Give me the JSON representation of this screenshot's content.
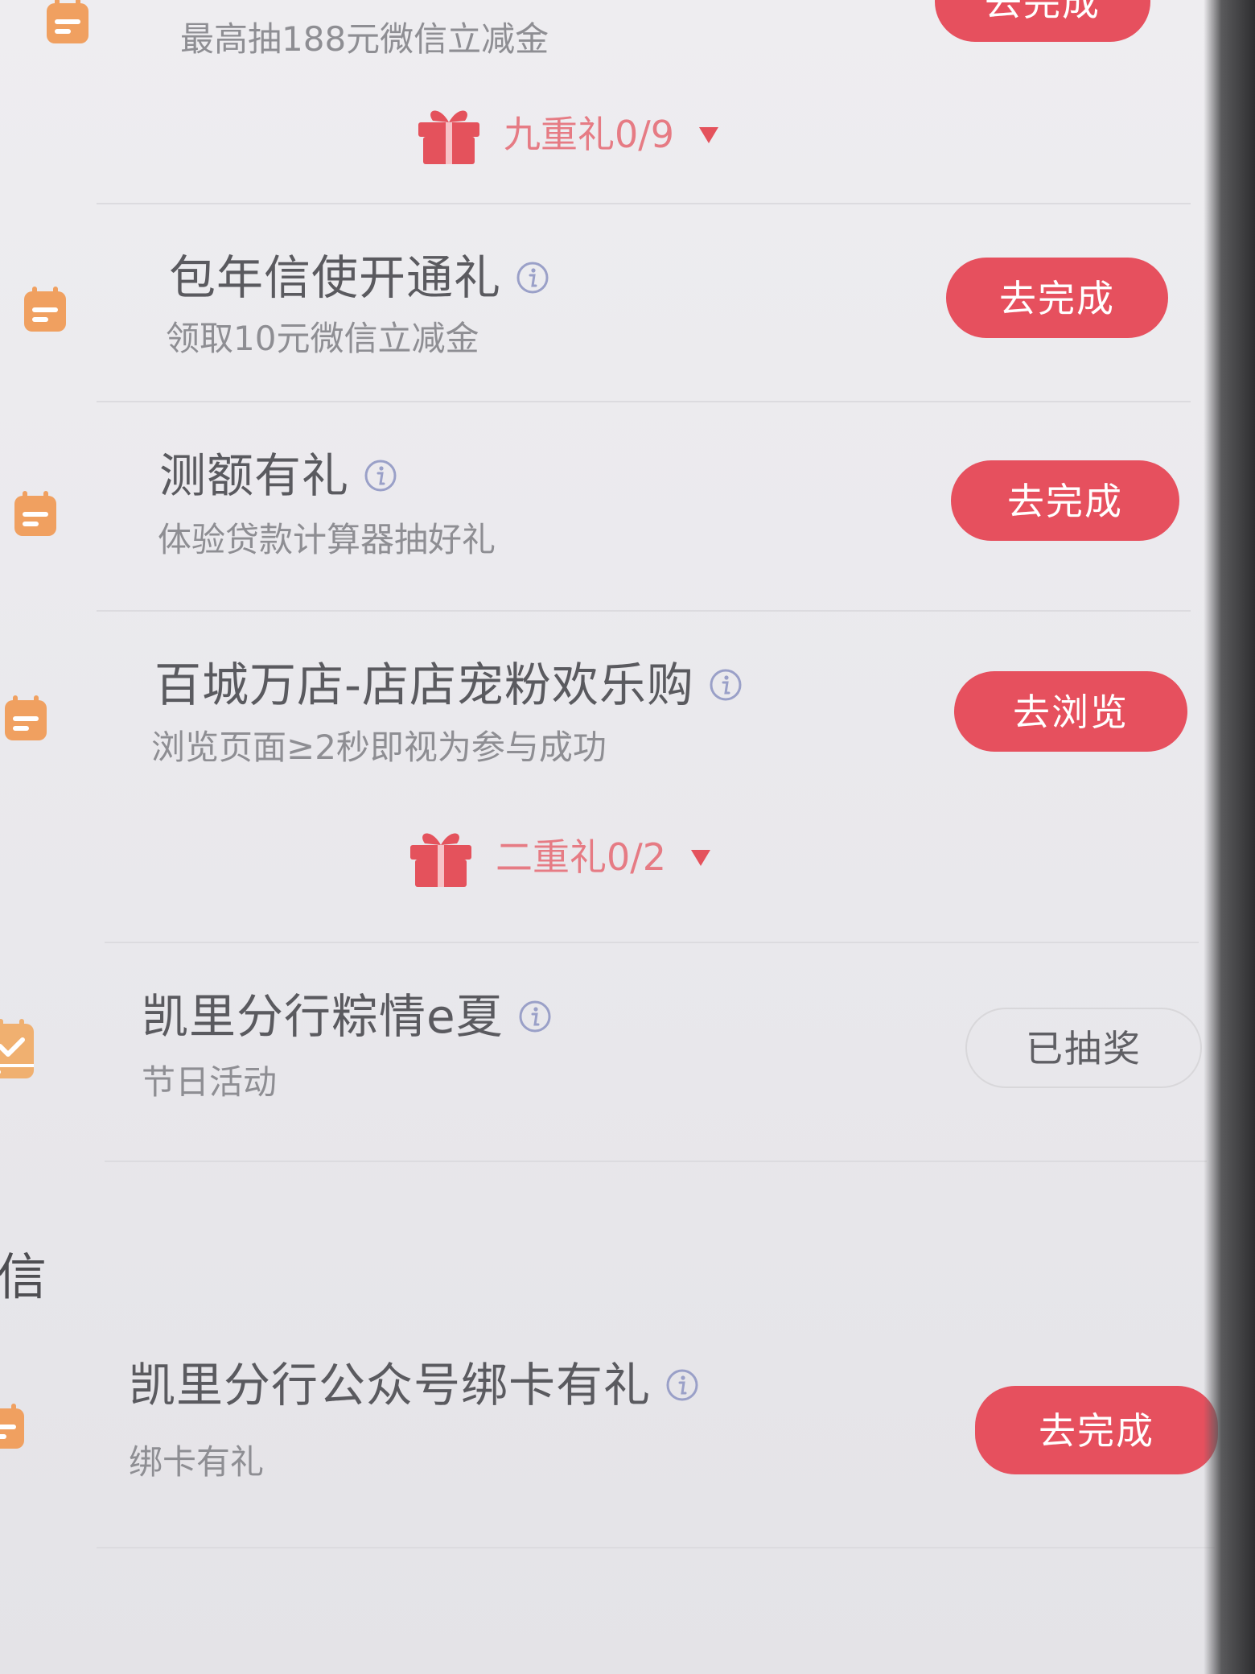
{
  "tasks": [
    {
      "title": "",
      "subtitle": "最高抽188元微信立减金",
      "button": "去完成",
      "state": "active"
    },
    {
      "title": "包年信使开通礼",
      "subtitle": "领取10元微信立减金",
      "button": "去完成",
      "state": "active"
    },
    {
      "title": "测额有礼",
      "subtitle": "体验贷款计算器抽好礼",
      "button": "去完成",
      "state": "active"
    },
    {
      "title": "百城万店-店店宠粉欢乐购",
      "subtitle": "浏览页面≥2秒即视为参与成功",
      "button": "去浏览",
      "state": "active"
    },
    {
      "title": "凯里分行粽情e夏",
      "subtitle": "节日活动",
      "button": "已抽奖",
      "state": "done"
    },
    {
      "title": "凯里分行公众号绑卡有礼",
      "subtitle": "绑卡有礼",
      "button": "去完成",
      "state": "active"
    }
  ],
  "gifts": {
    "nine": "九重礼0/9",
    "two": "二重礼0/2"
  },
  "section_fragment": "信",
  "colors": {
    "accent": "#e6505e",
    "icon_orange": "#f0a060",
    "icon_done": "#f0b070",
    "gift_red": "#e4525c",
    "info_blue": "#9aa0c8"
  },
  "icons": {
    "task": "calendar-icon",
    "task_done": "calendar-check-icon",
    "info": "info-icon",
    "gift": "gift-box-icon",
    "expand": "chevron-down-icon"
  }
}
